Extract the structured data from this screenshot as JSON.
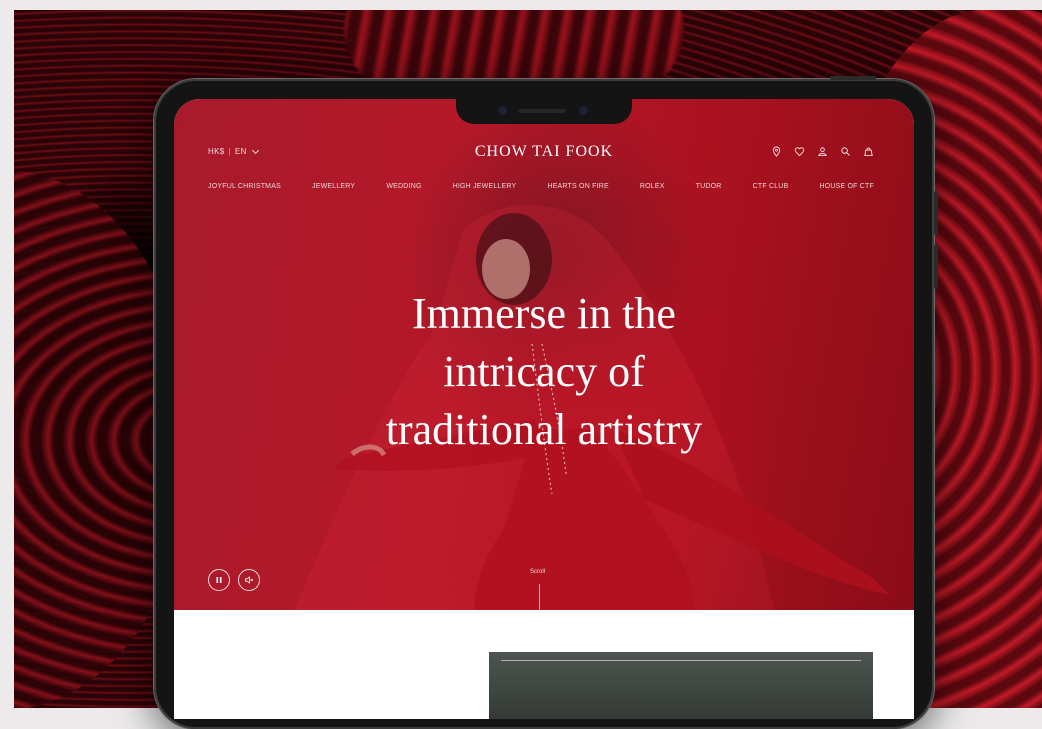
{
  "header": {
    "currency": "HK$",
    "separator": "|",
    "language": "EN",
    "brand": "CHOW TAI FOOK",
    "icons": [
      "location-pin-icon",
      "heart-icon",
      "user-icon",
      "search-icon",
      "shopping-bag-icon"
    ]
  },
  "nav": {
    "items": [
      "JOYFUL CHRISTMAS",
      "JEWELLERY",
      "WEDDING",
      "HIGH JEWELLERY",
      "HEARTS ON FIRE",
      "ROLEX",
      "TUDOR",
      "CTF CLUB",
      "HOUSE OF CTF"
    ]
  },
  "hero": {
    "headline_lines": [
      "Immerse in the",
      "intricacy of",
      "traditional artistry"
    ],
    "scroll_label": "Scroll",
    "controls": [
      "pause-icon",
      "mute-icon"
    ]
  },
  "colors": {
    "hero_red": "#b61828",
    "backdrop_red": "#c01a27",
    "device_frame": "#141414"
  }
}
